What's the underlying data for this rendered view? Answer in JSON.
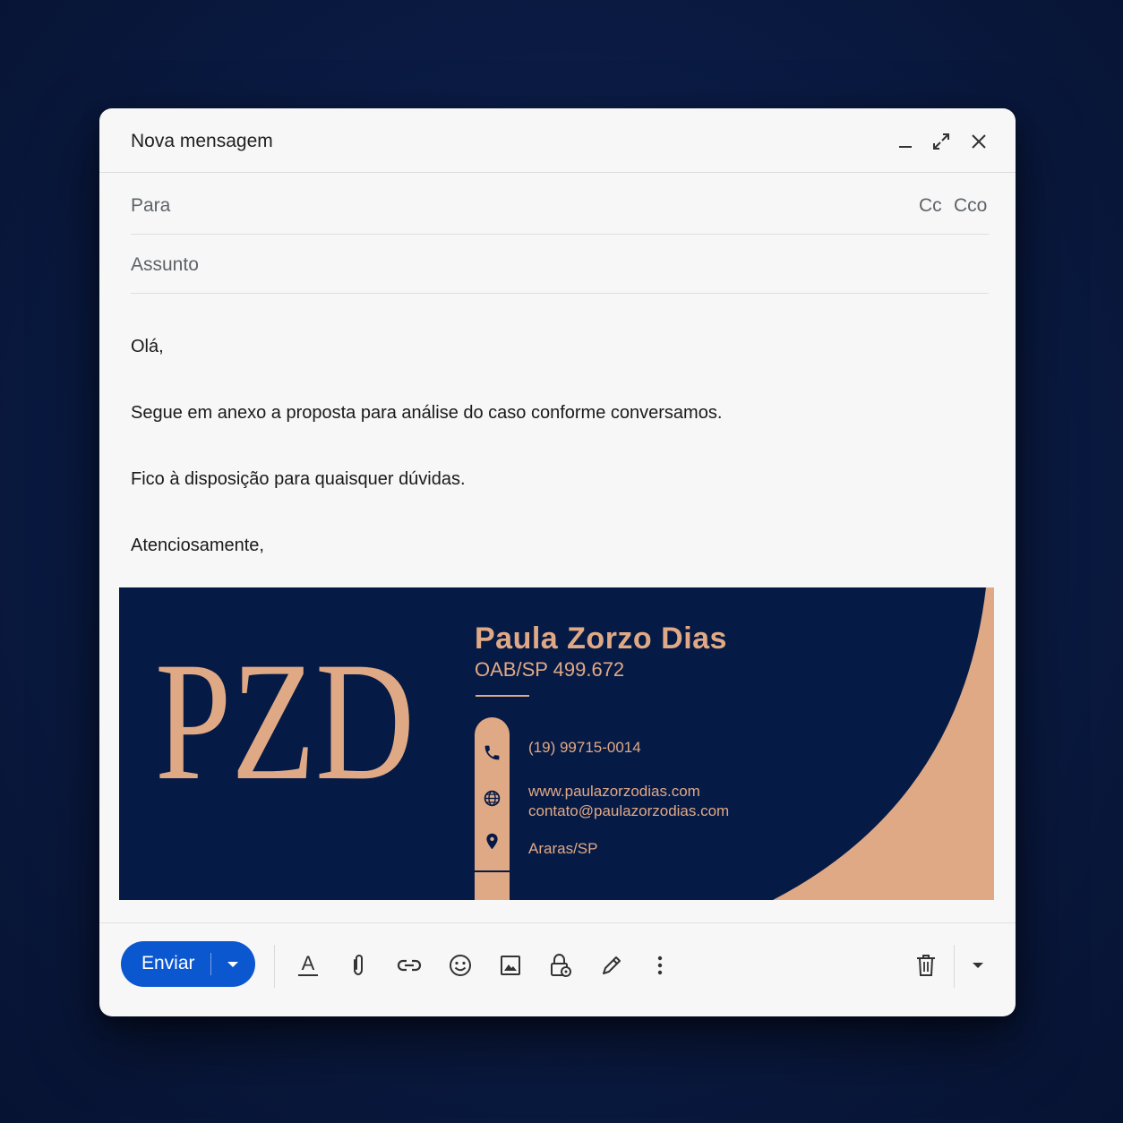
{
  "window": {
    "title": "Nova mensagem"
  },
  "fields": {
    "to_label": "Para",
    "cc_label": "Cc",
    "bcc_label": "Cco",
    "subject_label": "Assunto"
  },
  "body": {
    "greeting": "Olá,",
    "line1": "Segue em anexo a proposta para análise do caso conforme conversamos.",
    "line2": "Fico à disposição para quaisquer dúvidas.",
    "closing": "Atenciosamente,"
  },
  "signature": {
    "monogram": "PZD",
    "name": "Paula Zorzo Dias",
    "oab": "OAB/SP 499.672",
    "phone": "(19) 99715-0014",
    "website": "www.paulazorzodias.com",
    "email": "contato@paulazorzodias.com",
    "location": "Araras/SP",
    "colors": {
      "navy": "#061a46",
      "accent": "#e0a985"
    }
  },
  "toolbar": {
    "send_label": "Enviar",
    "icons": [
      "text-format-icon",
      "attach-icon",
      "link-icon",
      "emoji-icon",
      "image-icon",
      "confidential-lock-icon",
      "signature-pen-icon",
      "more-options-icon",
      "trash-icon",
      "more-caret-icon"
    ]
  },
  "colors": {
    "background": "#0b1c45",
    "window": "#f7f7f7",
    "send_button": "#0b57d0"
  }
}
